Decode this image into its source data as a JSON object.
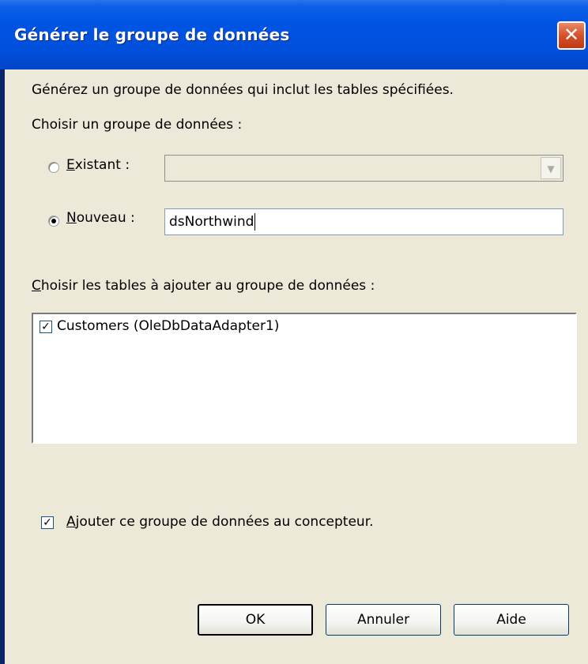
{
  "window": {
    "title": "Générer le groupe de données",
    "close_glyph": "✕"
  },
  "intro": "Générez un groupe de données qui inclut les tables spécifiées.",
  "choose_label": "Choisir un groupe de données :",
  "existing": {
    "label_accel": "E",
    "label_rest": "xistant :",
    "selected": false,
    "value": ""
  },
  "new": {
    "label_accel": "N",
    "label_rest": "ouveau :",
    "selected": true,
    "value": "dsNorthwind"
  },
  "tables_label": {
    "accel": "C",
    "rest": "hoisir les tables à ajouter au groupe de données :"
  },
  "tables": [
    {
      "label": "Customers (OleDbDataAdapter1)",
      "checked": true
    }
  ],
  "add_to_designer": {
    "accel": "A",
    "rest": "jouter ce groupe de données au concepteur.",
    "checked": true
  },
  "buttons": {
    "ok": "OK",
    "cancel": "Annuler",
    "help": "Aide"
  },
  "icons": {
    "close": "close-icon",
    "dropdown": "chevron-down-icon",
    "check": "checkmark-icon"
  }
}
